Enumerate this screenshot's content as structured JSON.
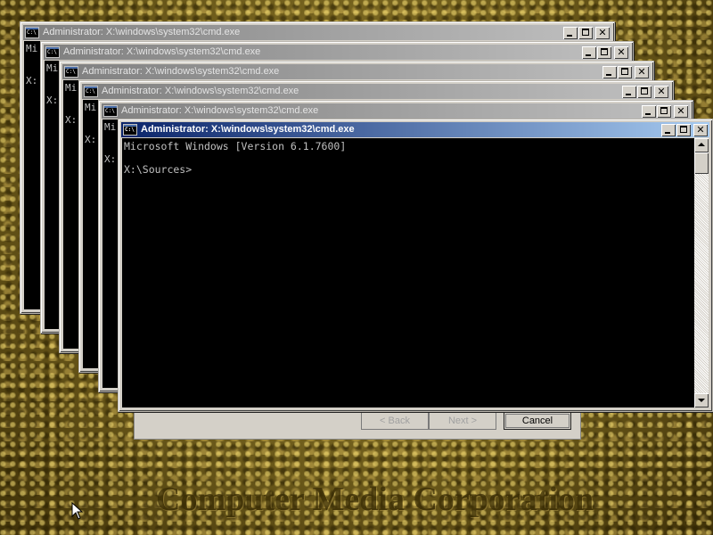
{
  "desktop": {
    "watermark": "Computer Media Corporation"
  },
  "setup_dialog": {
    "back_label": "< Back",
    "next_label": "Next >",
    "cancel_label": "Cancel"
  },
  "windows": [
    {
      "title": "Administrator: X:\\windows\\system32\\cmd.exe",
      "line1": "Mi",
      "line2": "X:"
    },
    {
      "title": "Administrator: X:\\windows\\system32\\cmd.exe",
      "line1": "Mi",
      "line2": "X:"
    },
    {
      "title": "Administrator: X:\\windows\\system32\\cmd.exe",
      "line1": "Mi",
      "line2": "X:"
    },
    {
      "title": "Administrator: X:\\windows\\system32\\cmd.exe",
      "line1": "Mi",
      "line2": "X:"
    },
    {
      "title": "Administrator: X:\\windows\\system32\\cmd.exe",
      "line1": "Mi",
      "line2": "X:"
    },
    {
      "title": "Administrator: X:\\windows\\system32\\cmd.exe",
      "console_text": "Microsoft Windows [Version 6.1.7600]\n\nX:\\Sources>"
    }
  ],
  "icons": {
    "system_menu": "cmd-icon",
    "minimize": "minimize-icon",
    "maximize": "maximize-icon",
    "close": "close-icon",
    "close_glyph": "✕",
    "cmd_glyph": "C:\\"
  },
  "colors": {
    "active_title_start": "#0a246a",
    "active_title_end": "#a6caf0",
    "console_bg": "#000000",
    "console_fg": "#c0c0c0",
    "window_face": "#d4d0c8"
  }
}
